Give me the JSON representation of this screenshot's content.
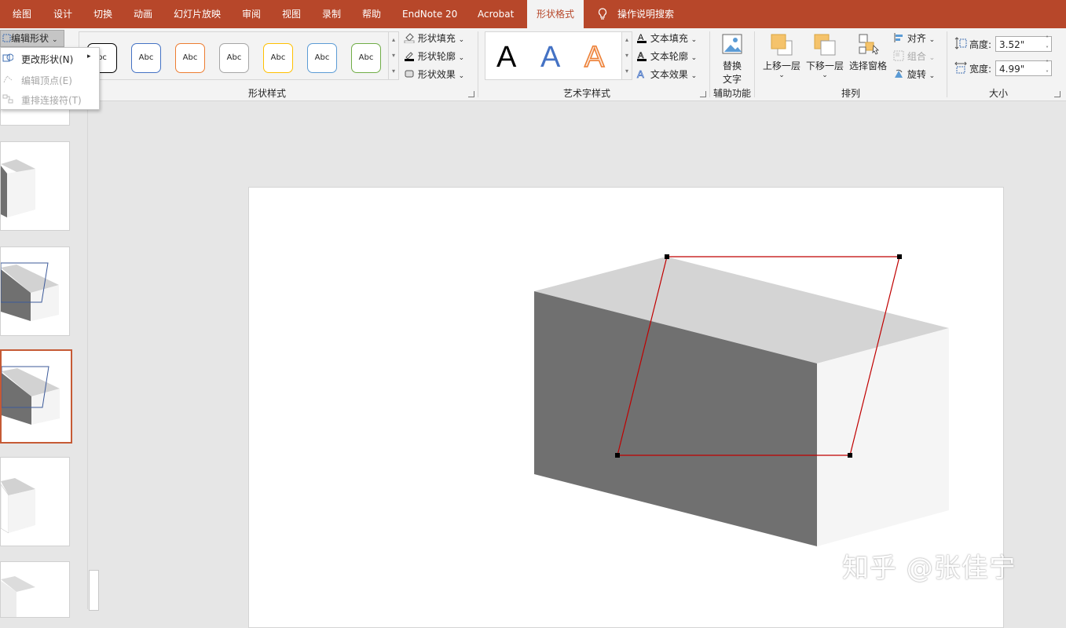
{
  "tabs": [
    "绘图",
    "设计",
    "切换",
    "动画",
    "幻灯片放映",
    "审阅",
    "视图",
    "录制",
    "帮助",
    "EndNote 20",
    "Acrobat",
    "形状格式",
    "操作说明搜索"
  ],
  "ribbon": {
    "edit_shape": "编辑形状",
    "gallery_abc": [
      "bc",
      "Abc",
      "Abc",
      "Abc",
      "Abc",
      "Abc",
      "Abc"
    ],
    "gallery_colors": [
      "#000000",
      "#4472c4",
      "#ed7d31",
      "#a5a5a5",
      "#ffc000",
      "#5b9bd5",
      "#70ad47"
    ],
    "shape_fill": "形状填充",
    "shape_outline": "形状轮廓",
    "shape_effects": "形状效果",
    "shape_styles_label": "形状样式",
    "wordart_letters": [
      "A",
      "A",
      "A"
    ],
    "text_fill": "文本填充",
    "text_outline": "文本轮廓",
    "text_effects": "文本效果",
    "wordart_label": "艺术字样式",
    "alt_text_1": "替换",
    "alt_text_2": "文字",
    "accessibility_label": "辅助功能",
    "bring_forward": "上移一层",
    "send_backward": "下移一层",
    "selection_pane": "选择窗格",
    "align": "对齐",
    "group": "组合",
    "rotate": "旋转",
    "arrange_label": "排列",
    "height_label": "高度:",
    "height_value": "3.52\"",
    "width_label": "宽度:",
    "width_value": "4.99\"",
    "size_label": "大小"
  },
  "menu": {
    "change_shape": "更改形状(N)",
    "edit_points": "编辑顶点(E)",
    "reroute": "重排连接符(T)"
  },
  "watermark": "知乎 @张佳宁",
  "colors": {
    "accent": "#b7472a",
    "selection_outline": "#c00000"
  }
}
